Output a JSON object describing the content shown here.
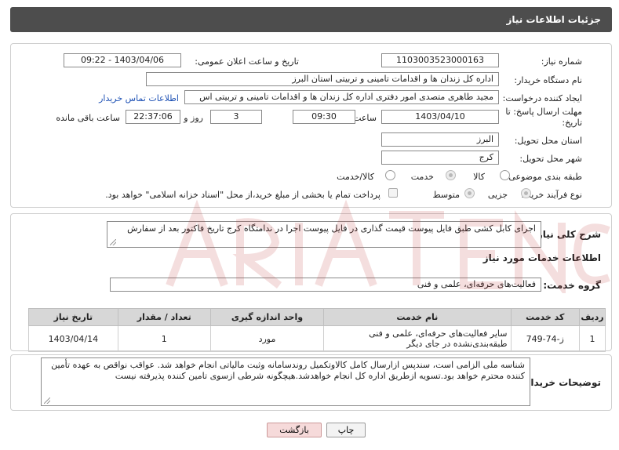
{
  "header": {
    "title": "جزئیات اطلاعات نیاز"
  },
  "form": {
    "need_number_label": "شماره نیاز:",
    "need_number": "1103003523000163",
    "announce_label": "تاریخ و ساعت اعلان عمومی:",
    "announce_value": "1403/04/06 - 09:22",
    "buyer_org_label": "نام دستگاه خریدار:",
    "buyer_org": "اداره کل زندان ها و اقدامات تامینی و تربیتی استان البرز",
    "requester_label": "ایجاد کننده درخواست:",
    "requester": "مجید طاهری متصدی امور دفتری اداره کل زندان ها و اقدامات تامینی و تربیتی اس",
    "contact_link": "اطلاعات تماس خریدار",
    "deadline_label_1": "مهلت ارسال پاسخ: تا",
    "deadline_label_2": "تاریخ:",
    "deadline_date": "1403/04/10",
    "time_label": "ساعت",
    "deadline_time": "09:30",
    "days_value": "3",
    "days_label": "روز و",
    "remaining_time": "22:37:06",
    "remaining_label": "ساعت باقی مانده",
    "province_label": "استان محل تحویل:",
    "province": "البرز",
    "city_label": "شهر محل تحویل:",
    "city": "کرج",
    "category_label": "طبقه بندی موضوعی:",
    "category_options": [
      "کالا",
      "خدمت",
      "کالا/خدمت"
    ],
    "category_selected": "خدمت",
    "process_label": "نوع فرآیند خرید :",
    "process_options": [
      "جزیی",
      "متوسط"
    ],
    "process_selected": "جزیی",
    "payment_note": "پرداخت تمام یا بخشی از مبلغ خرید،از محل \"اسناد خزانه اسلامی\" خواهد بود."
  },
  "description": {
    "label": "شرح کلی نیاز:",
    "text": "اجرای کابل کشی طبق فایل پیوست قیمت گذاری در فایل پیوست اجرا در ندامتگاه کرج تاریخ فاکتور بعد از سفارش"
  },
  "services": {
    "section_title": "اطلاعات خدمات مورد نیاز",
    "group_label": "گروه خدمت:",
    "group_value": "فعالیت‌های حرفه‌ای، علمی و فنی",
    "columns": [
      "ردیف",
      "کد خدمت",
      "نام خدمت",
      "واحد اندازه گیری",
      "تعداد / مقدار",
      "تاریخ نیاز"
    ],
    "rows": [
      {
        "index": "1",
        "code": "ز-74-749",
        "name": "سایر فعالیت‌های حرفه‌ای، علمی و فنی طبقه‌بندی‌نشده در جای دیگر",
        "unit": "مورد",
        "qty": "1",
        "date": "1403/04/14"
      }
    ]
  },
  "buyer_notes": {
    "label": "توضیحات خریدار:",
    "text": "شناسه ملی الزامی است، سندپس ازارسال کامل کالاوتکمیل روندسامانه وثبت مالیاتی انجام خواهد شد. عواقب نواقص به عهده تأمین کننده محترم خواهد بود.تسویه ازطریق اداره کل انجام خواهدشد.هیچگونه شرطی ازسوی تامین کننده پذیرفته نیست"
  },
  "buttons": {
    "print": "چاپ",
    "back": "بازگشت"
  },
  "colors": {
    "header_bg": "#4d4d4d",
    "link": "#1f52b5",
    "back_btn_bg": "#f6dada",
    "table_header_bg": "#d7d7d7"
  }
}
